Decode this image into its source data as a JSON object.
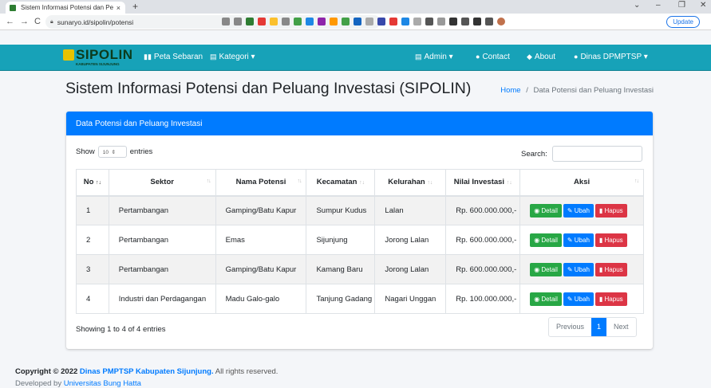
{
  "browser": {
    "tab_title": "Sistem Informasi Potensi dan Pel",
    "tab_close": "×",
    "new_tab": "+",
    "url": "sunaryo.id/sipolin/potensi",
    "update_label": "Update",
    "back": "←",
    "forward": "→",
    "reload": "C"
  },
  "navbar": {
    "brand_title": "SIPOLIN",
    "brand_subtitle": "KABUPATEN SIJUNJUNG",
    "items": [
      "Peta Sebaran",
      "Kategori ▾",
      "Admin ▾",
      "Contact",
      "About",
      "Dinas DPMPTSP ▾"
    ]
  },
  "page": {
    "title": "Sistem Informasi Potensi dan Peluang Investasi (SIPOLIN)",
    "breadcrumb_home": "Home",
    "breadcrumb_sep": "/",
    "breadcrumb_current": "Data Potensi dan Peluang Investasi"
  },
  "card": {
    "header": "Data Potensi dan Peluang Investasi",
    "show_label": "Show",
    "entries_value": "10",
    "entries_label": "entries",
    "search_label": "Search:",
    "columns": [
      "No",
      "Sektor",
      "Nama Potensi",
      "Kecamatan",
      "Kelurahan",
      "Nilai Investasi",
      "Aksi"
    ],
    "rows": [
      {
        "no": "1",
        "sektor": "Pertambangan",
        "nama": "Gamping/Batu Kapur",
        "kecamatan": "Sumpur Kudus",
        "kelurahan": "Lalan",
        "nilai": "Rp. 600.000.000,-"
      },
      {
        "no": "2",
        "sektor": "Pertambangan",
        "nama": "Emas",
        "kecamatan": "Sijunjung",
        "kelurahan": "Jorong Lalan",
        "nilai": "Rp. 600.000.000,-"
      },
      {
        "no": "3",
        "sektor": "Pertambangan",
        "nama": "Gamping/Batu Kapur",
        "kecamatan": "Kamang Baru",
        "kelurahan": "Jorong Lalan",
        "nilai": "Rp. 600.000.000,-"
      },
      {
        "no": "4",
        "sektor": "Industri dan Perdagangan",
        "nama": "Madu Galo-galo",
        "kecamatan": "Tanjung Gadang",
        "kelurahan": "Nagari Unggan",
        "nilai": "Rp. 100.000.000,-"
      }
    ],
    "actions": {
      "detail": "Detail",
      "ubah": "Ubah",
      "hapus": "Hapus"
    },
    "showing": "Showing 1 to 4 of 4 entries",
    "pager": {
      "previous": "Previous",
      "page": "1",
      "next": "Next"
    }
  },
  "footer": {
    "copyright_prefix": "Copyright © 2022",
    "org": "Dinas PMPTSP Kabupaten Sijunjung.",
    "rights": "All rights reserved.",
    "dev_prefix": "Developed by",
    "dev_org": "Universitas Bung Hatta"
  },
  "colors": {
    "navbar": "#17a2b8",
    "primary": "#007bff",
    "success": "#28a745",
    "danger": "#dc3545"
  }
}
